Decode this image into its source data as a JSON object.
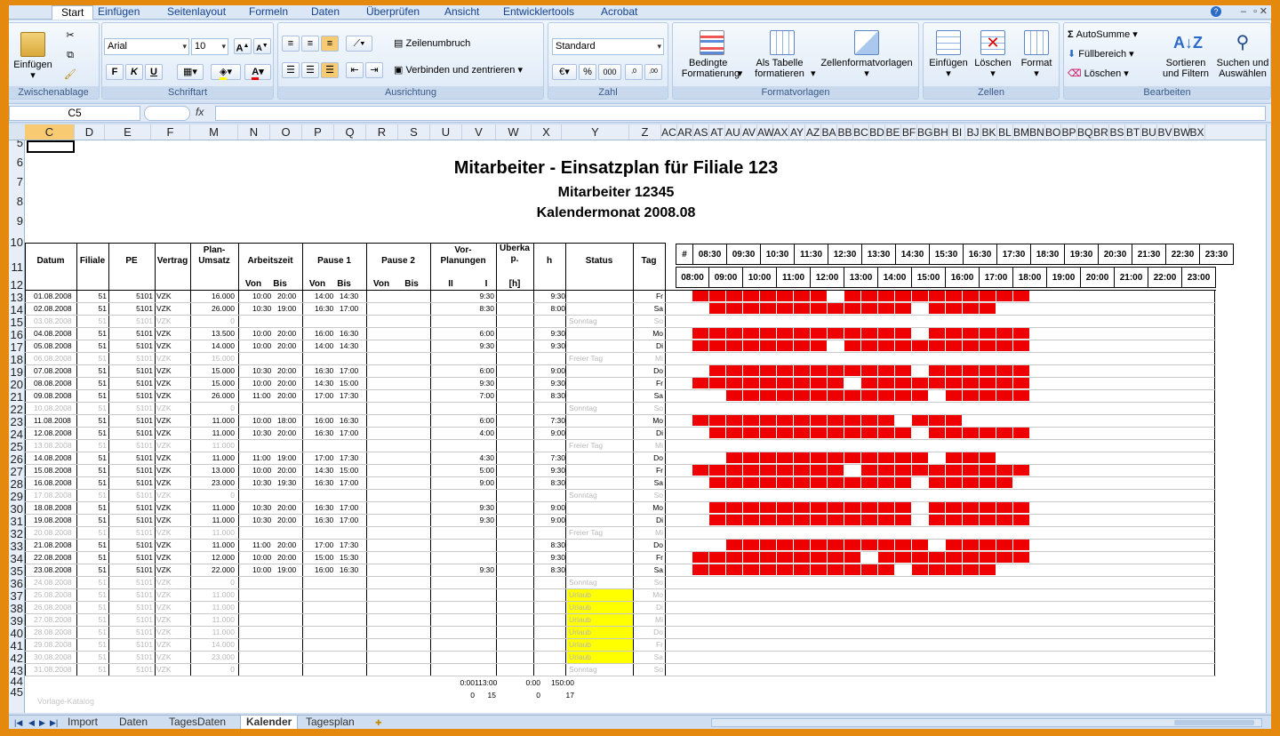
{
  "tabs": [
    "Start",
    "Einfügen",
    "Seitenlayout",
    "Formeln",
    "Daten",
    "Überprüfen",
    "Ansicht",
    "Entwicklertools",
    "Acrobat"
  ],
  "groups": {
    "clipboard": {
      "label": "Zwischenablage",
      "paste": "Einfügen"
    },
    "font": {
      "label": "Schriftart",
      "name": "Arial",
      "size": "10"
    },
    "alignment": {
      "label": "Ausrichtung",
      "wrap": "Zeilenumbruch",
      "merge": "Verbinden und zentrieren"
    },
    "number": {
      "label": "Zahl",
      "format": "Standard"
    },
    "styles": {
      "label": "Formatvorlagen",
      "cond": "Bedingte Formatierung",
      "table": "Als Tabelle formatieren",
      "cell": "Zellenformatvorlagen"
    },
    "cells": {
      "label": "Zellen",
      "insert": "Einfügen",
      "delete": "Löschen",
      "format": "Format"
    },
    "editing": {
      "label": "Bearbeiten",
      "autosum": "AutoSumme",
      "fill": "Füllbereich",
      "clear": "Löschen",
      "sort": "Sortieren und Filtern",
      "find": "Suchen und Auswählen"
    }
  },
  "namebox": "C5",
  "fx": "fx",
  "columns": [
    "C",
    "D",
    "E",
    "F",
    "M",
    "N",
    "O",
    "P",
    "Q",
    "R",
    "S",
    "U",
    "V",
    "W",
    "X",
    "Y",
    "Z",
    "AC",
    "AR",
    "AS",
    "AT",
    "AU",
    "AV",
    "AW",
    "AX",
    "AY",
    "AZ",
    "BA",
    "BB",
    "BC",
    "BD",
    "BE",
    "BF",
    "BG",
    "BH",
    "BI",
    "BJ",
    "BK",
    "BL",
    "BM",
    "BN",
    "BO",
    "BP",
    "BQ",
    "BR",
    "BS",
    "BT",
    "BU",
    "BV",
    "BW",
    "BX"
  ],
  "row_numbers": [
    "5",
    "6",
    "7",
    "8",
    "9",
    "10",
    "11",
    "12",
    "13",
    "14",
    "15",
    "16",
    "17",
    "18",
    "19",
    "20",
    "21",
    "22",
    "23",
    "24",
    "25",
    "26",
    "27",
    "28",
    "29",
    "30",
    "31",
    "32",
    "33",
    "34",
    "35",
    "36",
    "37",
    "38",
    "39",
    "40",
    "41",
    "42",
    "43",
    "44",
    "45"
  ],
  "title": "Mitarbeiter - Einsatzplan für Filiale 123",
  "subtitle1": "Mitarbeiter 12345",
  "subtitle2": "Kalendermonat 2008.08",
  "headers": {
    "datum": "Datum",
    "filiale": "Filiale",
    "pe": "PE",
    "vertrag": "Vertrag",
    "plan": "Plan-\nUmsatz",
    "arbeitszeit": "Arbeitszeit",
    "pause1": "Pause 1",
    "pause2": "Pause 2",
    "vorplan": "Vor-\nPlanungen",
    "ueberka": "Überka\np.",
    "h": "h",
    "status": "Status",
    "tag": "Tag",
    "von": "Von",
    "bis": "Bis",
    "II": "II",
    "I": "I",
    "hunit": "[h]",
    "hash": "#"
  },
  "times_top": [
    "08:30",
    "09:30",
    "10:30",
    "11:30",
    "12:30",
    "13:30",
    "14:30",
    "15:30",
    "16:30",
    "17:30",
    "18:30",
    "19:30",
    "20:30",
    "21:30",
    "22:30",
    "23:30"
  ],
  "times_bottom": [
    "08:00",
    "09:00",
    "10:00",
    "11:00",
    "12:00",
    "13:00",
    "14:00",
    "15:00",
    "16:00",
    "17:00",
    "18:00",
    "19:00",
    "20:00",
    "21:00",
    "22:00",
    "23:00"
  ],
  "rows": [
    {
      "d": "01.08.2008",
      "f": "51",
      "pe": "5101",
      "v": "VZK",
      "u": "16.000",
      "av": "10:00",
      "ab": "20:00",
      "p1v": "14:00",
      "p1b": "14:30",
      "vi": "9:30",
      "h": "9:30",
      "st": "",
      "t": "Fr",
      "dim": false,
      "bar": [
        0,
        1,
        1,
        1,
        1,
        1,
        1,
        1,
        1,
        0,
        1,
        1,
        1,
        1,
        1,
        1,
        1,
        1,
        1,
        1,
        1
      ]
    },
    {
      "d": "02.08.2008",
      "f": "51",
      "pe": "5101",
      "v": "VZK",
      "u": "26.000",
      "av": "10:30",
      "ab": "19:00",
      "p1v": "16:30",
      "p1b": "17:00",
      "vi": "8:30",
      "h": "8:00",
      "st": "",
      "t": "Sa",
      "dim": false,
      "bar": [
        0,
        0,
        1,
        1,
        1,
        1,
        1,
        1,
        1,
        1,
        1,
        1,
        1,
        1,
        0,
        1,
        1,
        1,
        1,
        0,
        0
      ]
    },
    {
      "d": "03.08.2008",
      "f": "51",
      "pe": "5101",
      "v": "VZK",
      "u": "0",
      "av": "",
      "ab": "",
      "p1v": "",
      "p1b": "",
      "vi": "",
      "h": "",
      "st": "Sonntag",
      "t": "So",
      "dim": true,
      "bar": []
    },
    {
      "d": "04.08.2008",
      "f": "51",
      "pe": "5101",
      "v": "VZK",
      "u": "13.500",
      "av": "10:00",
      "ab": "20:00",
      "p1v": "16:00",
      "p1b": "16:30",
      "vi": "6:00",
      "h": "9:30",
      "st": "",
      "t": "Mo",
      "dim": false,
      "bar": [
        0,
        1,
        1,
        1,
        1,
        1,
        1,
        1,
        1,
        1,
        1,
        1,
        1,
        1,
        0,
        1,
        1,
        1,
        1,
        1,
        1
      ]
    },
    {
      "d": "05.08.2008",
      "f": "51",
      "pe": "5101",
      "v": "VZK",
      "u": "14.000",
      "av": "10:00",
      "ab": "20:00",
      "p1v": "14:00",
      "p1b": "14:30",
      "vi": "9:30",
      "h": "9:30",
      "st": "",
      "t": "Di",
      "dim": false,
      "bar": [
        0,
        1,
        1,
        1,
        1,
        1,
        1,
        1,
        1,
        0,
        1,
        1,
        1,
        1,
        1,
        1,
        1,
        1,
        1,
        1,
        1
      ]
    },
    {
      "d": "06.08.2008",
      "f": "51",
      "pe": "5101",
      "v": "VZK",
      "u": "15.000",
      "av": "",
      "ab": "",
      "p1v": "",
      "p1b": "",
      "vi": "",
      "h": "",
      "st": "Freier Tag",
      "t": "Mi",
      "dim": true,
      "bar": []
    },
    {
      "d": "07.08.2008",
      "f": "51",
      "pe": "5101",
      "v": "VZK",
      "u": "15.000",
      "av": "10:30",
      "ab": "20:00",
      "p1v": "16:30",
      "p1b": "17:00",
      "vi": "6:00",
      "h": "9:00",
      "st": "",
      "t": "Do",
      "dim": false,
      "bar": [
        0,
        0,
        1,
        1,
        1,
        1,
        1,
        1,
        1,
        1,
        1,
        1,
        1,
        1,
        0,
        1,
        1,
        1,
        1,
        1,
        1
      ]
    },
    {
      "d": "08.08.2008",
      "f": "51",
      "pe": "5101",
      "v": "VZK",
      "u": "15.000",
      "av": "10:00",
      "ab": "20:00",
      "p1v": "14:30",
      "p1b": "15:00",
      "vi": "9:30",
      "h": "9:30",
      "st": "",
      "t": "Fr",
      "dim": false,
      "bar": [
        0,
        1,
        1,
        1,
        1,
        1,
        1,
        1,
        1,
        1,
        0,
        1,
        1,
        1,
        1,
        1,
        1,
        1,
        1,
        1,
        1
      ]
    },
    {
      "d": "09.08.2008",
      "f": "51",
      "pe": "5101",
      "v": "VZK",
      "u": "26.000",
      "av": "11:00",
      "ab": "20:00",
      "p1v": "17:00",
      "p1b": "17:30",
      "vi": "7:00",
      "h": "8:30",
      "st": "",
      "t": "Sa",
      "dim": false,
      "bar": [
        0,
        0,
        0,
        1,
        1,
        1,
        1,
        1,
        1,
        1,
        1,
        1,
        1,
        1,
        1,
        0,
        1,
        1,
        1,
        1,
        1
      ]
    },
    {
      "d": "10.08.2008",
      "f": "51",
      "pe": "5101",
      "v": "VZK",
      "u": "0",
      "av": "",
      "ab": "",
      "p1v": "",
      "p1b": "",
      "vi": "",
      "h": "",
      "st": "Sonntag",
      "t": "So",
      "dim": true,
      "bar": []
    },
    {
      "d": "11.08.2008",
      "f": "51",
      "pe": "5101",
      "v": "VZK",
      "u": "11.000",
      "av": "10:00",
      "ab": "18:00",
      "p1v": "16:00",
      "p1b": "16:30",
      "vi": "6:00",
      "h": "7:30",
      "st": "",
      "t": "Mo",
      "dim": false,
      "bar": [
        0,
        1,
        1,
        1,
        1,
        1,
        1,
        1,
        1,
        1,
        1,
        1,
        1,
        0,
        1,
        1,
        1,
        0,
        0,
        0,
        0
      ]
    },
    {
      "d": "12.08.2008",
      "f": "51",
      "pe": "5101",
      "v": "VZK",
      "u": "11.000",
      "av": "10:30",
      "ab": "20:00",
      "p1v": "16:30",
      "p1b": "17:00",
      "vi": "4:00",
      "h": "9:00",
      "st": "",
      "t": "Di",
      "dim": false,
      "bar": [
        0,
        0,
        1,
        1,
        1,
        1,
        1,
        1,
        1,
        1,
        1,
        1,
        1,
        1,
        0,
        1,
        1,
        1,
        1,
        1,
        1
      ]
    },
    {
      "d": "13.08.2008",
      "f": "51",
      "pe": "5101",
      "v": "VZK",
      "u": "11.000",
      "av": "",
      "ab": "",
      "p1v": "",
      "p1b": "",
      "vi": "",
      "h": "",
      "st": "Freier Tag",
      "t": "Mi",
      "dim": true,
      "bar": []
    },
    {
      "d": "14.08.2008",
      "f": "51",
      "pe": "5101",
      "v": "VZK",
      "u": "11.000",
      "av": "11:00",
      "ab": "19:00",
      "p1v": "17:00",
      "p1b": "17:30",
      "vi": "4:30",
      "h": "7:30",
      "st": "",
      "t": "Do",
      "dim": false,
      "bar": [
        0,
        0,
        0,
        1,
        1,
        1,
        1,
        1,
        1,
        1,
        1,
        1,
        1,
        1,
        1,
        0,
        1,
        1,
        1,
        0,
        0
      ]
    },
    {
      "d": "15.08.2008",
      "f": "51",
      "pe": "5101",
      "v": "VZK",
      "u": "13.000",
      "av": "10:00",
      "ab": "20:00",
      "p1v": "14:30",
      "p1b": "15:00",
      "vi": "5:00",
      "h": "9:30",
      "st": "",
      "t": "Fr",
      "dim": false,
      "bar": [
        0,
        1,
        1,
        1,
        1,
        1,
        1,
        1,
        1,
        1,
        0,
        1,
        1,
        1,
        1,
        1,
        1,
        1,
        1,
        1,
        1
      ]
    },
    {
      "d": "16.08.2008",
      "f": "51",
      "pe": "5101",
      "v": "VZK",
      "u": "23.000",
      "av": "10:30",
      "ab": "19:30",
      "p1v": "16:30",
      "p1b": "17:00",
      "vi": "9:00",
      "h": "8:30",
      "st": "",
      "t": "Sa",
      "dim": false,
      "bar": [
        0,
        0,
        1,
        1,
        1,
        1,
        1,
        1,
        1,
        1,
        1,
        1,
        1,
        1,
        0,
        1,
        1,
        1,
        1,
        1,
        0
      ]
    },
    {
      "d": "17.08.2008",
      "f": "51",
      "pe": "5101",
      "v": "VZK",
      "u": "0",
      "av": "",
      "ab": "",
      "p1v": "",
      "p1b": "",
      "vi": "",
      "h": "",
      "st": "Sonntag",
      "t": "So",
      "dim": true,
      "bar": []
    },
    {
      "d": "18.08.2008",
      "f": "51",
      "pe": "5101",
      "v": "VZK",
      "u": "11.000",
      "av": "10:30",
      "ab": "20:00",
      "p1v": "16:30",
      "p1b": "17:00",
      "vi": "9:30",
      "h": "9:00",
      "st": "",
      "t": "Mo",
      "dim": false,
      "bar": [
        0,
        0,
        1,
        1,
        1,
        1,
        1,
        1,
        1,
        1,
        1,
        1,
        1,
        1,
        0,
        1,
        1,
        1,
        1,
        1,
        1
      ]
    },
    {
      "d": "19.08.2008",
      "f": "51",
      "pe": "5101",
      "v": "VZK",
      "u": "11.000",
      "av": "10:30",
      "ab": "20:00",
      "p1v": "16:30",
      "p1b": "17:00",
      "vi": "9:30",
      "h": "9:00",
      "st": "",
      "t": "Di",
      "dim": false,
      "bar": [
        0,
        0,
        1,
        1,
        1,
        1,
        1,
        1,
        1,
        1,
        1,
        1,
        1,
        1,
        0,
        1,
        1,
        1,
        1,
        1,
        1
      ]
    },
    {
      "d": "20.08.2008",
      "f": "51",
      "pe": "5101",
      "v": "VZK",
      "u": "11.000",
      "av": "",
      "ab": "",
      "p1v": "",
      "p1b": "",
      "vi": "",
      "h": "",
      "st": "Freier Tag",
      "t": "Mi",
      "dim": true,
      "bar": []
    },
    {
      "d": "21.08.2008",
      "f": "51",
      "pe": "5101",
      "v": "VZK",
      "u": "11.000",
      "av": "11:00",
      "ab": "20:00",
      "p1v": "17:00",
      "p1b": "17:30",
      "vi": "",
      "h": "8:30",
      "st": "",
      "t": "Do",
      "dim": false,
      "bar": [
        0,
        0,
        0,
        1,
        1,
        1,
        1,
        1,
        1,
        1,
        1,
        1,
        1,
        1,
        1,
        0,
        1,
        1,
        1,
        1,
        1
      ]
    },
    {
      "d": "22.08.2008",
      "f": "51",
      "pe": "5101",
      "v": "VZK",
      "u": "12.000",
      "av": "10:00",
      "ab": "20:00",
      "p1v": "15:00",
      "p1b": "15:30",
      "vi": "",
      "h": "9:30",
      "st": "",
      "t": "Fr",
      "dim": false,
      "bar": [
        0,
        1,
        1,
        1,
        1,
        1,
        1,
        1,
        1,
        1,
        1,
        0,
        1,
        1,
        1,
        1,
        1,
        1,
        1,
        1,
        1
      ]
    },
    {
      "d": "23.08.2008",
      "f": "51",
      "pe": "5101",
      "v": "VZK",
      "u": "22.000",
      "av": "10:00",
      "ab": "19:00",
      "p1v": "16:00",
      "p1b": "16:30",
      "vi": "9:30",
      "h": "8:30",
      "st": "",
      "t": "Sa",
      "dim": false,
      "bar": [
        0,
        1,
        1,
        1,
        1,
        1,
        1,
        1,
        1,
        1,
        1,
        1,
        1,
        0,
        1,
        1,
        1,
        1,
        1,
        0,
        0
      ]
    },
    {
      "d": "24.08.2008",
      "f": "51",
      "pe": "5101",
      "v": "VZK",
      "u": "0",
      "av": "",
      "ab": "",
      "p1v": "",
      "p1b": "",
      "vi": "",
      "h": "",
      "st": "Sonntag",
      "t": "So",
      "dim": true,
      "bar": []
    },
    {
      "d": "25.08.2008",
      "f": "51",
      "pe": "5101",
      "v": "VZK",
      "u": "11.000",
      "av": "",
      "ab": "",
      "p1v": "",
      "p1b": "",
      "vi": "",
      "h": "",
      "st": "Urlaub",
      "t": "Mo",
      "dim": true,
      "bar": []
    },
    {
      "d": "26.08.2008",
      "f": "51",
      "pe": "5101",
      "v": "VZK",
      "u": "11.000",
      "av": "",
      "ab": "",
      "p1v": "",
      "p1b": "",
      "vi": "",
      "h": "",
      "st": "Urlaub",
      "t": "Di",
      "dim": true,
      "bar": []
    },
    {
      "d": "27.08.2008",
      "f": "51",
      "pe": "5101",
      "v": "VZK",
      "u": "11.000",
      "av": "",
      "ab": "",
      "p1v": "",
      "p1b": "",
      "vi": "",
      "h": "",
      "st": "Urlaub",
      "t": "Mi",
      "dim": true,
      "bar": []
    },
    {
      "d": "28.08.2008",
      "f": "51",
      "pe": "5101",
      "v": "VZK",
      "u": "11.000",
      "av": "",
      "ab": "",
      "p1v": "",
      "p1b": "",
      "vi": "",
      "h": "",
      "st": "Urlaub",
      "t": "Do",
      "dim": true,
      "bar": []
    },
    {
      "d": "29.08.2008",
      "f": "51",
      "pe": "5101",
      "v": "VZK",
      "u": "14.000",
      "av": "",
      "ab": "",
      "p1v": "",
      "p1b": "",
      "vi": "",
      "h": "",
      "st": "Urlaub",
      "t": "Fr",
      "dim": true,
      "bar": []
    },
    {
      "d": "30.08.2008",
      "f": "51",
      "pe": "5101",
      "v": "VZK",
      "u": "23.000",
      "av": "",
      "ab": "",
      "p1v": "",
      "p1b": "",
      "vi": "",
      "h": "",
      "st": "Urlaub",
      "t": "Sa",
      "dim": true,
      "bar": []
    },
    {
      "d": "31.08.2008",
      "f": "51",
      "pe": "5101",
      "v": "VZK",
      "u": "0",
      "av": "",
      "ab": "",
      "p1v": "",
      "p1b": "",
      "vi": "",
      "h": "",
      "st": "Sonntag",
      "t": "So",
      "dim": true,
      "bar": []
    }
  ],
  "totals": {
    "r1": [
      "0:00",
      "113:00",
      "0:00",
      "150:00"
    ],
    "r2": [
      "0",
      "15",
      "0",
      "17"
    ]
  },
  "watermark": "Vorlage-Katalog",
  "sheet_tabs": [
    "Import",
    "Daten",
    "TagesDaten",
    "Kalender",
    "Tagesplan"
  ],
  "active_sheet": "Kalender",
  "colors": {
    "bar": "#ee0000",
    "vacation": "#ffff00",
    "selected_col": "#f8cb73",
    "frame": "#e5890e"
  }
}
